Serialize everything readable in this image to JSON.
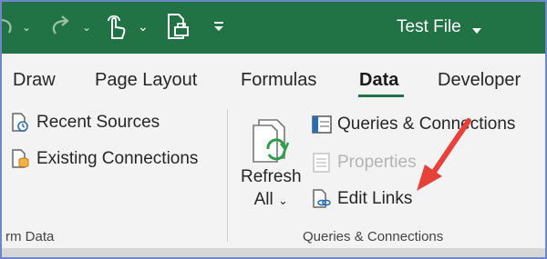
{
  "title_bar": {
    "file_title": "Test File",
    "background": "#217346"
  },
  "tabs": {
    "items": [
      {
        "label": "Draw"
      },
      {
        "label": "Page Layout"
      },
      {
        "label": "Formulas"
      },
      {
        "label": "Data",
        "active": true
      },
      {
        "label": "Developer"
      }
    ],
    "accent": "#217346"
  },
  "ribbon": {
    "left_group": {
      "label": "rm Data",
      "recent_sources": "Recent Sources",
      "existing_connections": "Existing Connections"
    },
    "queries_group": {
      "label": "Queries & Connections",
      "refresh_line1": "Refresh",
      "refresh_line2": "All",
      "queries_connections": "Queries & Connections",
      "properties": "Properties",
      "edit_links": "Edit Links"
    }
  },
  "annotation": {
    "arrow_color": "#e8413a",
    "arrow_points_to": "Edit Links"
  }
}
